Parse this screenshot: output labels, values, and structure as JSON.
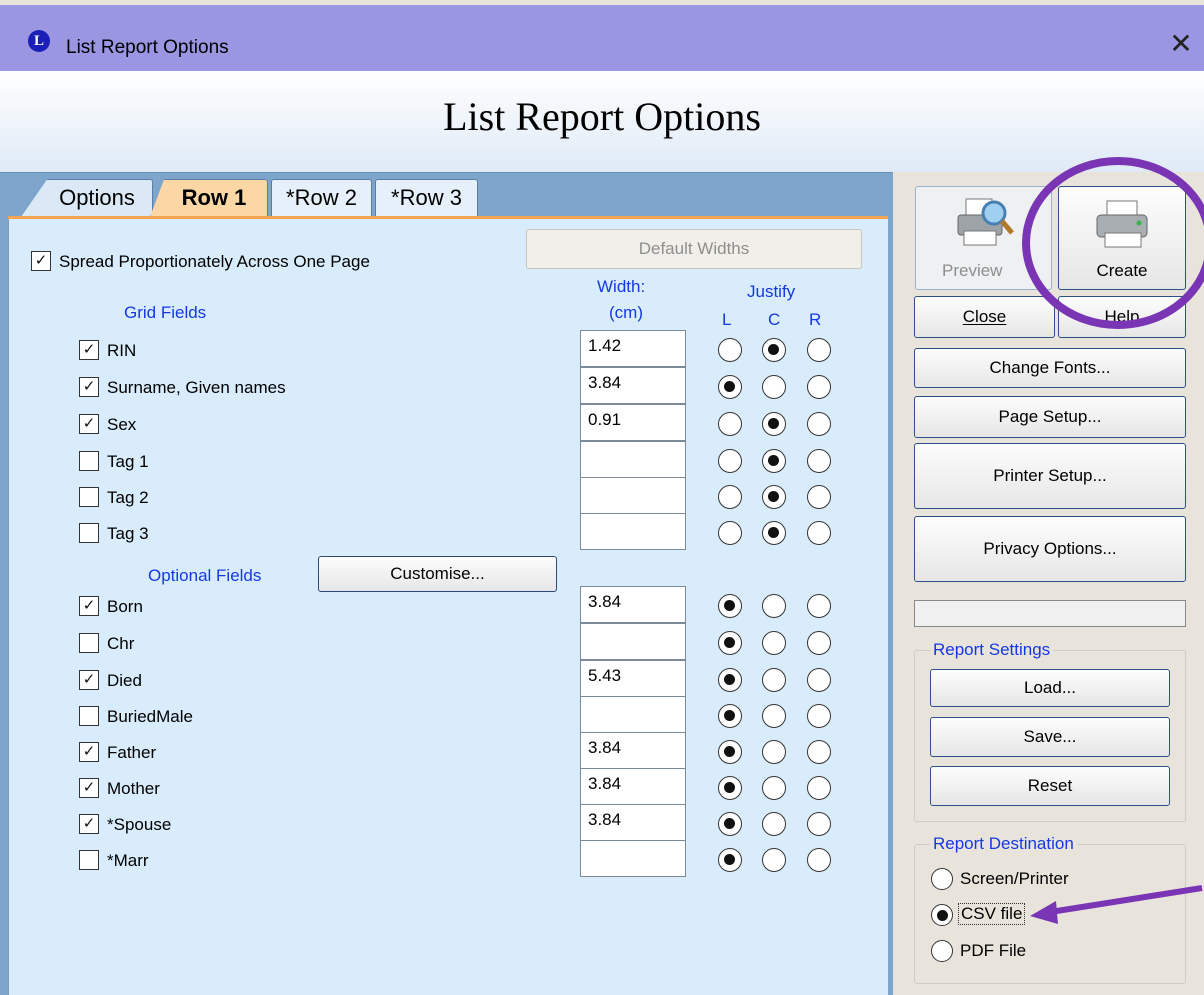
{
  "window": {
    "app_icon_letter": "L",
    "title": "List Report Options",
    "close_glyph": "✕"
  },
  "header": {
    "title": "List Report Options"
  },
  "tabs": [
    {
      "label": "Options",
      "active": false
    },
    {
      "label": "Row 1",
      "active": true
    },
    {
      "label": "*Row 2",
      "active": false
    },
    {
      "label": "*Row 3",
      "active": false
    }
  ],
  "row_tab": {
    "spread_label": "Spread Proportionately Across One Page",
    "spread_checked": true,
    "default_widths_label": "Default Widths",
    "width_header": "Width:",
    "width_unit": "(cm)",
    "justify_header": "Justify",
    "justify_cols": [
      "L",
      "C",
      "R"
    ],
    "grid_fields_label": "Grid Fields",
    "optional_fields_label": "Optional Fields",
    "customise_label": "Customise...",
    "grid_fields": [
      {
        "label": "RIN",
        "checked": true,
        "width": "1.42",
        "justify": "C"
      },
      {
        "label": "Surname, Given names",
        "checked": true,
        "width": "3.84",
        "justify": "L"
      },
      {
        "label": "Sex",
        "checked": true,
        "width": "0.91",
        "justify": "C"
      },
      {
        "label": "Tag 1",
        "checked": false,
        "width": "",
        "justify": "C"
      },
      {
        "label": "Tag 2",
        "checked": false,
        "width": "",
        "justify": "C"
      },
      {
        "label": "Tag 3",
        "checked": false,
        "width": "",
        "justify": "C"
      }
    ],
    "optional_fields": [
      {
        "label": "Born",
        "checked": true,
        "width": "3.84",
        "justify": "L"
      },
      {
        "label": "Chr",
        "checked": false,
        "width": "",
        "justify": "L"
      },
      {
        "label": "Died",
        "checked": true,
        "width": "5.43",
        "justify": "L"
      },
      {
        "label": "BuriedMale",
        "checked": false,
        "width": "",
        "justify": "L"
      },
      {
        "label": "Father",
        "checked": true,
        "width": "3.84",
        "justify": "L"
      },
      {
        "label": "Mother",
        "checked": true,
        "width": "3.84",
        "justify": "L"
      },
      {
        "label": "*Spouse",
        "checked": true,
        "width": "3.84",
        "justify": "L"
      },
      {
        "label": "*Marr",
        "checked": false,
        "width": "",
        "justify": "L"
      }
    ]
  },
  "side": {
    "preview_label": "Preview",
    "create_label": "Create",
    "close_label": "Close",
    "help_label": "Help",
    "change_fonts_label": "Change Fonts...",
    "page_setup_label": "Page Setup...",
    "printer_setup_label": "Printer Setup...",
    "privacy_options_label": "Privacy Options...",
    "report_settings_title": "Report Settings",
    "load_label": "Load...",
    "save_label": "Save...",
    "reset_label": "Reset",
    "report_destination_title": "Report Destination",
    "destinations": [
      {
        "label": "Screen/Printer",
        "selected": false
      },
      {
        "label": "CSV file",
        "selected": true
      },
      {
        "label": "PDF File",
        "selected": false
      }
    ]
  },
  "annotation_color": "#7a35b5",
  "accent_blue": "#1438e6",
  "tab_active_color": "#fbd7a6"
}
